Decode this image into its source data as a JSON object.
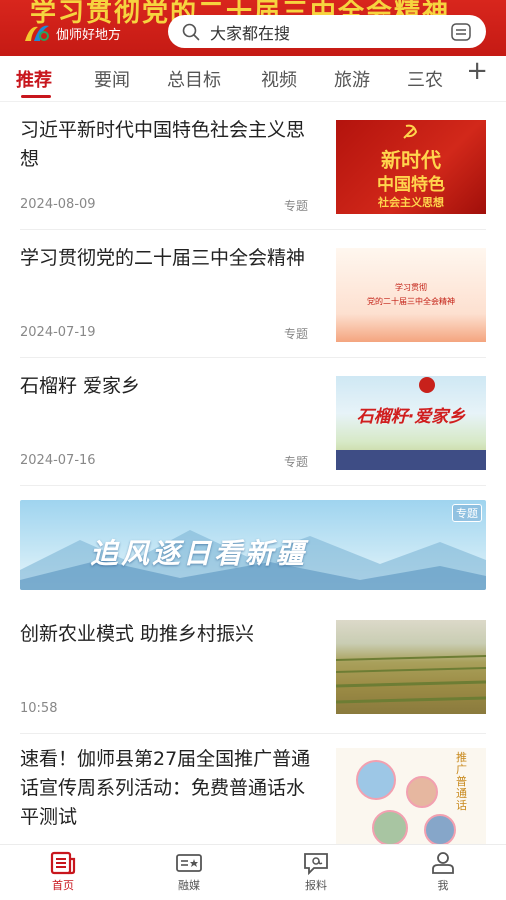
{
  "header": {
    "banner_text": "学习贯彻党的二十届三中全会精神",
    "logo_text": "伽师好地方",
    "search_placeholder": "大家都在搜"
  },
  "tabs": [
    {
      "label": "推荐",
      "active": true
    },
    {
      "label": "要闻"
    },
    {
      "label": "总目标"
    },
    {
      "label": "视频"
    },
    {
      "label": "旅游"
    },
    {
      "label": "三农"
    }
  ],
  "add_tab_label": "+",
  "feed": [
    {
      "title": "习近平新时代中国特色社会主义思想",
      "date": "2024-08-09",
      "tag": "专题",
      "thumb_text": [
        "新时代",
        "中国特色",
        "社会主义思想"
      ]
    },
    {
      "title": "学习贯彻党的二十届三中全会精神",
      "date": "2024-07-19",
      "tag": "专题",
      "thumb_text": [
        "学习贯彻",
        "党的二十届三中全会精神"
      ]
    },
    {
      "title": "石榴籽 爱家乡",
      "date": "2024-07-16",
      "tag": "专题",
      "thumb_text": [
        "石榴籽·爱家乡"
      ]
    }
  ],
  "banner": {
    "text": "追风逐日看新疆",
    "tag": "专题"
  },
  "feed2": [
    {
      "title": "创新农业模式 助推乡村振兴",
      "date": "10:58"
    },
    {
      "title": "速看！伽师县第27届全国推广普通话宣传周系列活动：免费普通话水平测试",
      "thumb_text": "推广普通话"
    }
  ],
  "bottom_nav": [
    {
      "label": "首页",
      "icon": "home-news-icon",
      "active": true
    },
    {
      "label": "融媒",
      "icon": "media-icon"
    },
    {
      "label": "报料",
      "icon": "report-icon"
    },
    {
      "label": "我",
      "icon": "profile-icon"
    }
  ],
  "colors": {
    "brand_red": "#c8161d",
    "header_gold": "#f6d43f"
  }
}
